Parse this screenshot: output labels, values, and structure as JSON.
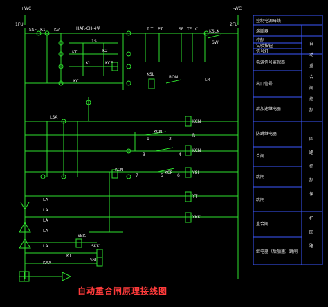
{
  "title": "自动重合闸原理接线图",
  "bus_left": {
    "top": "+WC",
    "bottom": "1FU"
  },
  "bus_right": {
    "top": "-WC",
    "bottom": "2FU"
  },
  "labels": {
    "ssf": "SSF",
    "k1": "K1",
    "kv": "KV",
    "relay_block": "HAR-CH-4型",
    "one_s": "1S",
    "kt": "KT",
    "k2": "K2",
    "kl": "KL",
    "kcf": "KCF",
    "kc": "KC",
    "tt": "T T",
    "pt": "PT",
    "sf": "SF",
    "tf": "TF",
    "c": "C",
    "sw_label": "SW",
    "kslk": "KSLK",
    "ksl": "KSL",
    "ron": "RON",
    "xb": "XB",
    "lr": "LR",
    "lsa": "LSA",
    "kcn": "KCN",
    "kcn2": "KCN",
    "r": "R",
    "kcn3": "KCN",
    "ysi": "YSI",
    "yt": "YT",
    "kcf_contact": "KCF",
    "kcn_coil": "KCN",
    "ykk": "YKK",
    "s1": "1",
    "s2": "2",
    "s3": "3",
    "s4": "4",
    "s5": "5",
    "s6": "6",
    "s7": "7",
    "la1": "LA",
    "la2": "LA",
    "la3": "LA",
    "la4": "LA",
    "la5": "LA",
    "kt2": "KT",
    "sbk": "SBK",
    "skk": "SKK",
    "ssl": "SSL",
    "kxx": "KXX"
  },
  "table": {
    "rows": [
      "控制电源母线",
      "熔断器",
      "控制",
      "试验按钮",
      "信号灯",
      "电源信号监视器",
      "出口信号",
      "后加速继电器",
      "防跳继电器",
      "合闸",
      "跳闸",
      "跳闸",
      "重合闸",
      "继电器（后加速）跳闸"
    ],
    "side_col": [
      "自",
      "动",
      "重",
      "合",
      "闸",
      "控",
      "制",
      "回",
      "路",
      "控",
      "制",
      "保",
      "护",
      "回",
      "路"
    ]
  }
}
